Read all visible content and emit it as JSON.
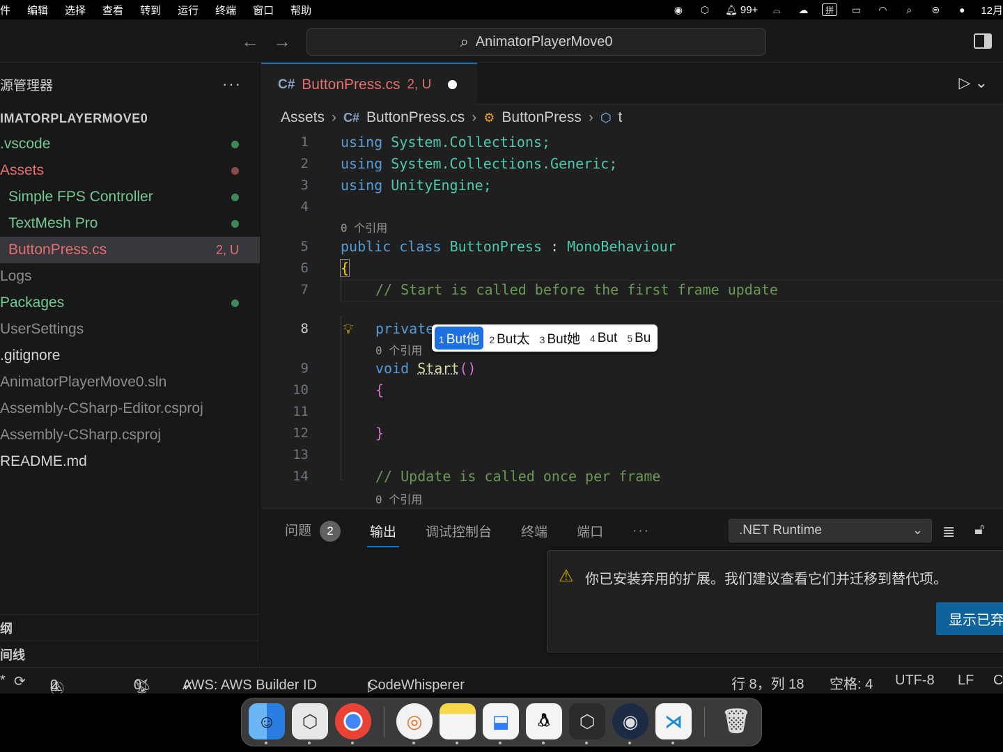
{
  "menubar": {
    "items": [
      "件",
      "编辑",
      "选择",
      "查看",
      "转到",
      "运行",
      "终端",
      "窗口",
      "帮助"
    ],
    "notif_count": "99+",
    "clock": "12月"
  },
  "titlebar": {
    "search_text": "AnimatorPlayerMove0"
  },
  "sidebar": {
    "header": "源管理器",
    "project": "IMATORPLAYERMOVE0",
    "items": [
      {
        "label": ".vscode",
        "color": "#73c991",
        "dot": "#3d8a55"
      },
      {
        "label": "Assets",
        "color": "#e2706e",
        "dot": "#8a4a48"
      },
      {
        "label": "Simple FPS Controller",
        "color": "#73c991",
        "dot": "#3d8a55"
      },
      {
        "label": "TextMesh Pro",
        "color": "#73c991",
        "dot": "#3d8a55"
      },
      {
        "label": "ButtonPress.cs",
        "color": "#e2706e",
        "badge": "2, U"
      },
      {
        "label": "Logs",
        "color": "#8c8c8c"
      },
      {
        "label": "Packages",
        "color": "#73c991",
        "dot": "#3d8a55"
      },
      {
        "label": "UserSettings",
        "color": "#8c8c8c"
      },
      {
        "label": ".gitignore",
        "color": "#d4d4d4"
      },
      {
        "label": "AnimatorPlayerMove0.sln",
        "color": "#8c8c8c"
      },
      {
        "label": "Assembly-CSharp-Editor.csproj",
        "color": "#8c8c8c"
      },
      {
        "label": "Assembly-CSharp.csproj",
        "color": "#8c8c8c"
      },
      {
        "label": "README.md",
        "color": "#d4d4d4"
      }
    ],
    "bottom1": "纲",
    "bottom2": "间线"
  },
  "editor": {
    "tab_name": "ButtonPress.cs",
    "tab_badge": "2, U",
    "breadcrumb": [
      "Assets",
      "ButtonPress.cs",
      "ButtonPress",
      "t"
    ],
    "lens_ref": "0 个引用",
    "lines": {
      "l1": [
        "using",
        "System.Collections;"
      ],
      "l2": [
        "using",
        "System.Collections.Generic;"
      ],
      "l3": [
        "using",
        "UnityEngine;"
      ],
      "l5": [
        "public",
        "class",
        "ButtonPress",
        ":",
        "MonoBehaviour"
      ],
      "l6": "{",
      "l7": "// Start is called before the first frame update",
      "l8": "private",
      "l9": [
        "void",
        "Start",
        "()"
      ],
      "l10": "{",
      "l12": "}",
      "l14": "// Update is called once per frame"
    },
    "line_numbers": [
      "1",
      "2",
      "3",
      "4",
      "5",
      "6",
      "7",
      "8",
      "9",
      "10",
      "11",
      "12",
      "13",
      "14"
    ]
  },
  "ime": {
    "candidates": [
      {
        "num": "1",
        "text": "But他"
      },
      {
        "num": "2",
        "text": "But太"
      },
      {
        "num": "3",
        "text": "But她"
      },
      {
        "num": "4",
        "text": "But"
      },
      {
        "num": "5",
        "text": "Bu"
      }
    ]
  },
  "panel": {
    "tabs": {
      "problems": "问题",
      "problems_count": "2",
      "output": "输出",
      "debug": "调试控制台",
      "terminal": "终端",
      "ports": "端口"
    },
    "output_channel": ".NET Runtime"
  },
  "notification": {
    "text": "你已安装弃用的扩展。我们建议查看它们并迁移到替代项。",
    "button": "显示已弃"
  },
  "statusbar": {
    "branch": "*",
    "errors": "2",
    "warnings": "0",
    "ports": "0",
    "aws": "AWS: AWS Builder ID",
    "codewhisperer": "CodeWhisperer",
    "position": "行 8，列 18",
    "spaces": "空格: 4",
    "encoding": "UTF-8",
    "eol": "LF",
    "lang": "C"
  },
  "colors": {
    "accent": "#0078d4",
    "keyword": "#569cd6",
    "type": "#4ec9b0",
    "comment": "#6a9955"
  }
}
